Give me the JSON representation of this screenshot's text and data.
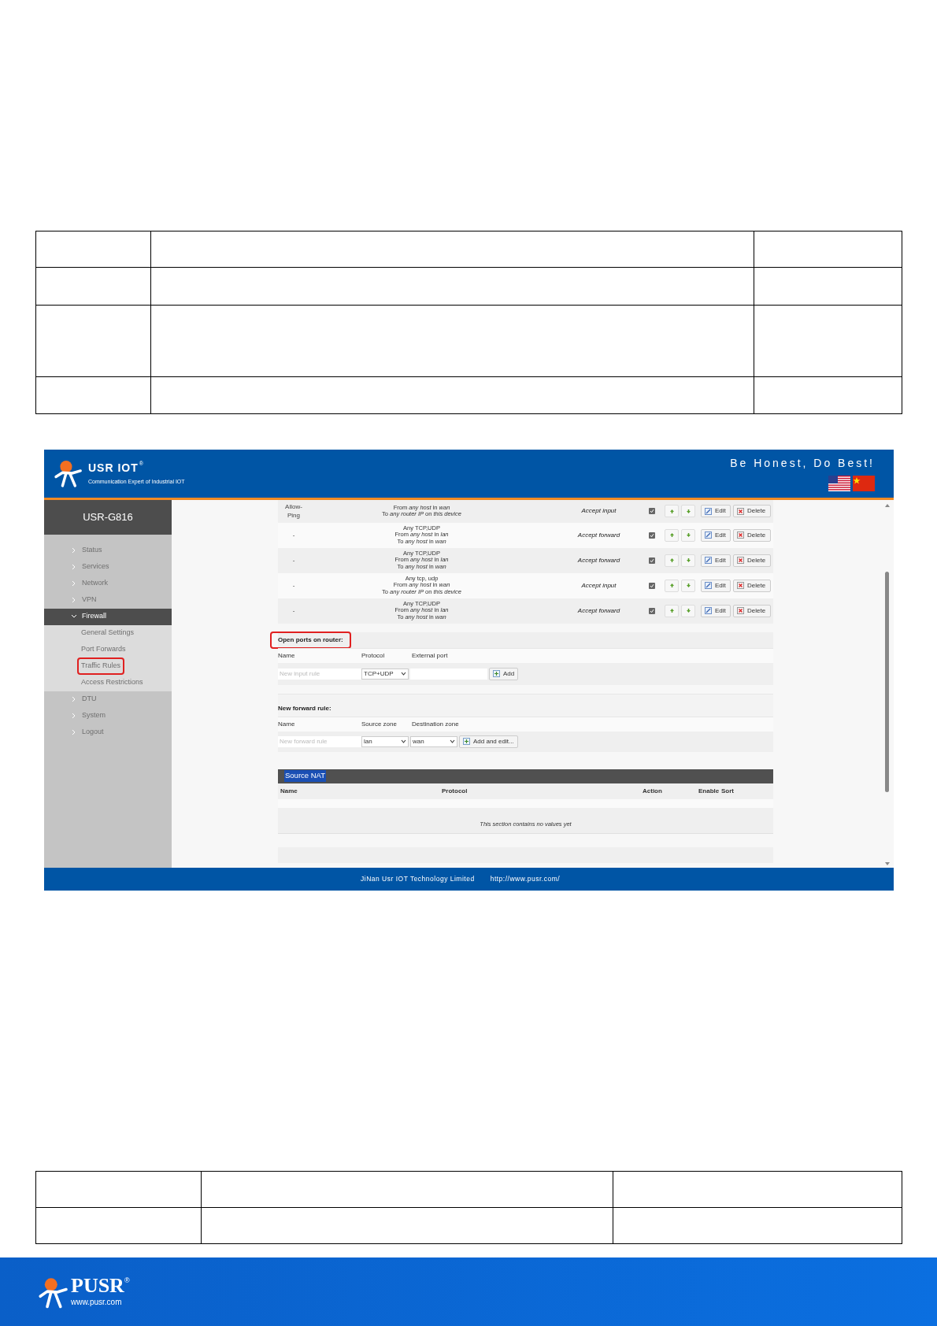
{
  "router_ui": {
    "header": {
      "brand": "USR IOT",
      "brand_mark": "®",
      "tagline": "Communication Expert of Industrial IOT",
      "slogan": "Be Honest, Do Best!"
    },
    "sidebar": {
      "title": "USR-G816",
      "items": [
        {
          "label": "Status",
          "expanded": false
        },
        {
          "label": "Services",
          "expanded": false
        },
        {
          "label": "Network",
          "expanded": false
        },
        {
          "label": "VPN",
          "expanded": false
        },
        {
          "label": "Firewall",
          "expanded": true,
          "children": [
            {
              "label": "General Settings",
              "highlighted": false
            },
            {
              "label": "Port Forwards",
              "highlighted": false
            },
            {
              "label": "Traffic Rules",
              "highlighted": true
            },
            {
              "label": "Access Restrictions",
              "highlighted": false
            }
          ]
        },
        {
          "label": "DTU",
          "expanded": false
        },
        {
          "label": "System",
          "expanded": false
        },
        {
          "label": "Logout",
          "expanded": false
        }
      ]
    },
    "rules": [
      {
        "name": "Allow-Ping",
        "match": [
          "From *any host* in *wan*",
          "To *any router IP* on *this device*"
        ],
        "action": "Accept input",
        "enabled": true,
        "buttons": [
          "Edit",
          "Delete"
        ]
      },
      {
        "name": "-",
        "match": [
          "Any TCP,UDP",
          "From *any host* in *lan*",
          "To *any host* in *wan*"
        ],
        "action": "Accept forward",
        "enabled": true,
        "buttons": [
          "Edit",
          "Delete"
        ]
      },
      {
        "name": "-",
        "match": [
          "Any TCP,UDP",
          "From *any host* in *lan*",
          "To *any host* in *wan*"
        ],
        "action": "Accept forward",
        "enabled": true,
        "buttons": [
          "Edit",
          "Delete"
        ]
      },
      {
        "name": "-",
        "match": [
          "Any tcp, udp",
          "From *any host* in *wan*",
          "To *any router IP* on *this device*"
        ],
        "action": "Accept input",
        "enabled": true,
        "buttons": [
          "Edit",
          "Delete"
        ]
      },
      {
        "name": "-",
        "match": [
          "Any TCP,UDP",
          "From *any host* in *lan*",
          "To *any host* in *wan*"
        ],
        "action": "Accept forward",
        "enabled": true,
        "buttons": [
          "Edit",
          "Delete"
        ]
      }
    ],
    "open_ports": {
      "title": "Open ports on router:",
      "highlighted": true,
      "columns": [
        "Name",
        "Protocol",
        "External port"
      ],
      "name_placeholder": "New input rule",
      "protocol": "TCP+UDP",
      "button": "Add"
    },
    "new_forward": {
      "title": "New forward rule:",
      "columns": [
        "Name",
        "Source zone",
        "Destination zone"
      ],
      "name_placeholder": "New forward rule",
      "source_zone": "lan",
      "destination_zone": "wan",
      "button": "Add and edit..."
    },
    "source_nat": {
      "title": "Source NAT",
      "columns": [
        "Name",
        "Protocol",
        "Action",
        "Enable",
        "Sort"
      ],
      "empty_message": "This section contains no values yet"
    },
    "footer": {
      "company": "JiNan Usr IOT Technology Limited",
      "url": "http://www.pusr.com/"
    }
  },
  "page_footer": {
    "brand": "PUSR",
    "brand_mark": "®",
    "url": "www.pusr.com"
  }
}
